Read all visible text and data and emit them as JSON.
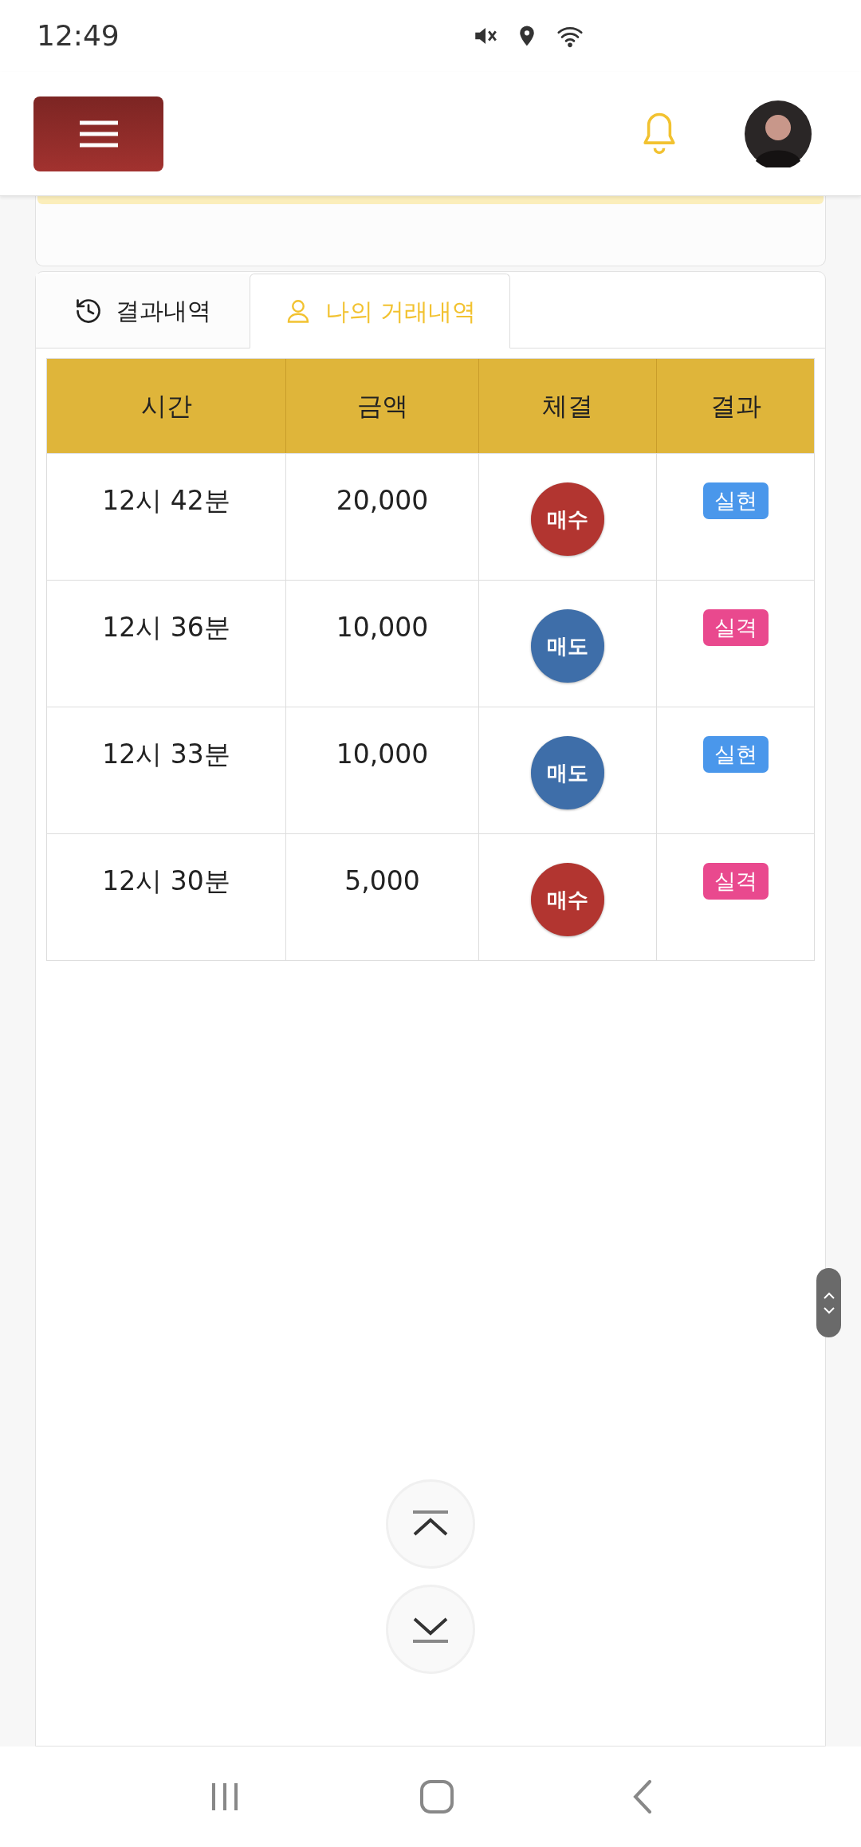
{
  "status_bar": {
    "time": "12:49"
  },
  "tabs": [
    {
      "label": "결과내역",
      "kind": "history",
      "selected": false
    },
    {
      "label": "나의 거래내역",
      "kind": "user",
      "selected": true
    }
  ],
  "table": {
    "columns": [
      "시간",
      "금액",
      "체결",
      "결과"
    ],
    "rows": [
      {
        "time": "12시 42분",
        "amount": "20,000",
        "trade": {
          "label": "매수",
          "color": "#b23530"
        },
        "result": {
          "label": "실현",
          "color": "#4a97eb"
        }
      },
      {
        "time": "12시 36분",
        "amount": "10,000",
        "trade": {
          "label": "매도",
          "color": "#3e6ea9"
        },
        "result": {
          "label": "실격",
          "color": "#e9498e"
        }
      },
      {
        "time": "12시 33분",
        "amount": "10,000",
        "trade": {
          "label": "매도",
          "color": "#3e6ea9"
        },
        "result": {
          "label": "실현",
          "color": "#4a97eb"
        }
      },
      {
        "time": "12시 30분",
        "amount": "5,000",
        "trade": {
          "label": "매수",
          "color": "#b23530"
        },
        "result": {
          "label": "실격",
          "color": "#e9498e"
        }
      }
    ]
  }
}
